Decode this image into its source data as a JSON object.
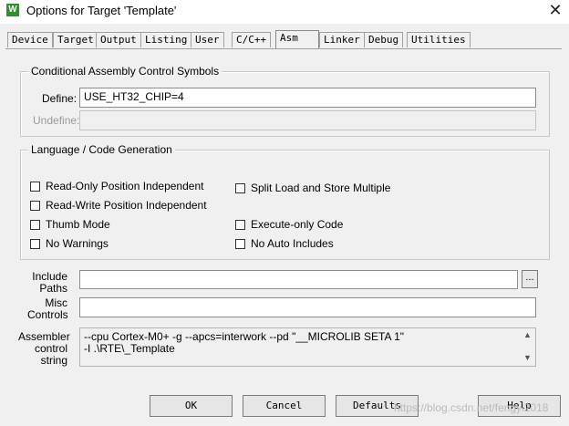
{
  "window": {
    "title": "Options for Target 'Template'",
    "close_glyph": "✕",
    "icon_letter": "W"
  },
  "tabs": [
    {
      "label": "Device"
    },
    {
      "label": "Target"
    },
    {
      "label": "Output"
    },
    {
      "label": "Listing"
    },
    {
      "label": "User"
    },
    {
      "label": "C/C++"
    },
    {
      "label": "Asm",
      "active": true
    },
    {
      "label": "Linker"
    },
    {
      "label": "Debug"
    },
    {
      "label": "Utilities"
    }
  ],
  "conditional": {
    "title": "Conditional Assembly Control Symbols",
    "define_label": "Define:",
    "define_value": "USE_HT32_CHIP=4",
    "undefine_label": "Undefine:",
    "undefine_value": ""
  },
  "language": {
    "title": "Language / Code Generation",
    "options": {
      "ropi": {
        "label": "Read-Only Position Independent",
        "checked": false
      },
      "rwpi": {
        "label": "Read-Write Position Independent",
        "checked": false
      },
      "thumb": {
        "label": "Thumb Mode",
        "checked": false
      },
      "nowarn": {
        "label": "No Warnings",
        "checked": false
      },
      "split": {
        "label": "Split Load and Store Multiple",
        "checked": false
      },
      "execonly": {
        "label": "Execute-only Code",
        "checked": false
      },
      "noauto": {
        "label": "No Auto Includes",
        "checked": false
      }
    }
  },
  "include": {
    "label_line1": "Include",
    "label_line2": "Paths",
    "value": "",
    "browse_label": "..."
  },
  "misc": {
    "label_line1": "Misc",
    "label_line2": "Controls",
    "value": ""
  },
  "assembler": {
    "label_line1": "Assembler",
    "label_line2": "control",
    "label_line3": "string",
    "line1": "--cpu Cortex-M0+ -g --apcs=interwork --pd \"__MICROLIB SETA 1\"",
    "line2": "-I .\\RTE\\_Template"
  },
  "buttons": {
    "ok": "OK",
    "cancel": "Cancel",
    "defaults": "Defaults",
    "help": "Help"
  },
  "watermark": "https://blog.csdn.net/fengyi2018"
}
